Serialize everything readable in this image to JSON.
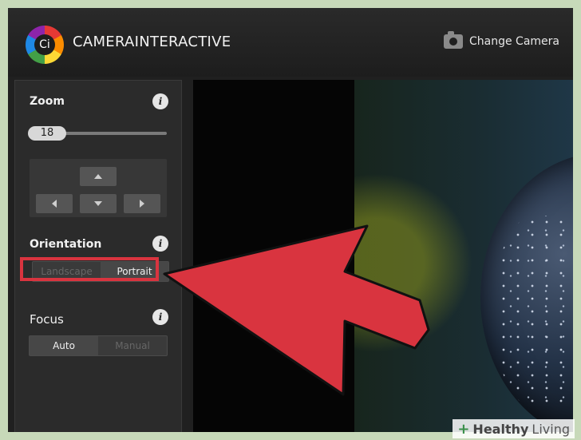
{
  "header": {
    "brand": "CAMERAINTERACTIVE",
    "logo_glyph": "Ci",
    "change_camera_label": "Change Camera"
  },
  "controls": {
    "zoom": {
      "title": "Zoom",
      "info": "i",
      "value": "18",
      "level_fraction": 0.18
    },
    "orientation": {
      "title": "Orientation",
      "info": "i",
      "options": [
        "Landscape",
        "Portrait"
      ],
      "selected": "Portrait"
    },
    "focus": {
      "title": "Focus",
      "info": "i",
      "options": [
        "Auto",
        "Manual"
      ],
      "selected": "Auto"
    }
  },
  "annotation": {
    "arrow_color": "#d9343f",
    "box_color": "#d9343f"
  },
  "watermark": {
    "plus": "+",
    "bold": "Healthy",
    "rest": "Living"
  }
}
